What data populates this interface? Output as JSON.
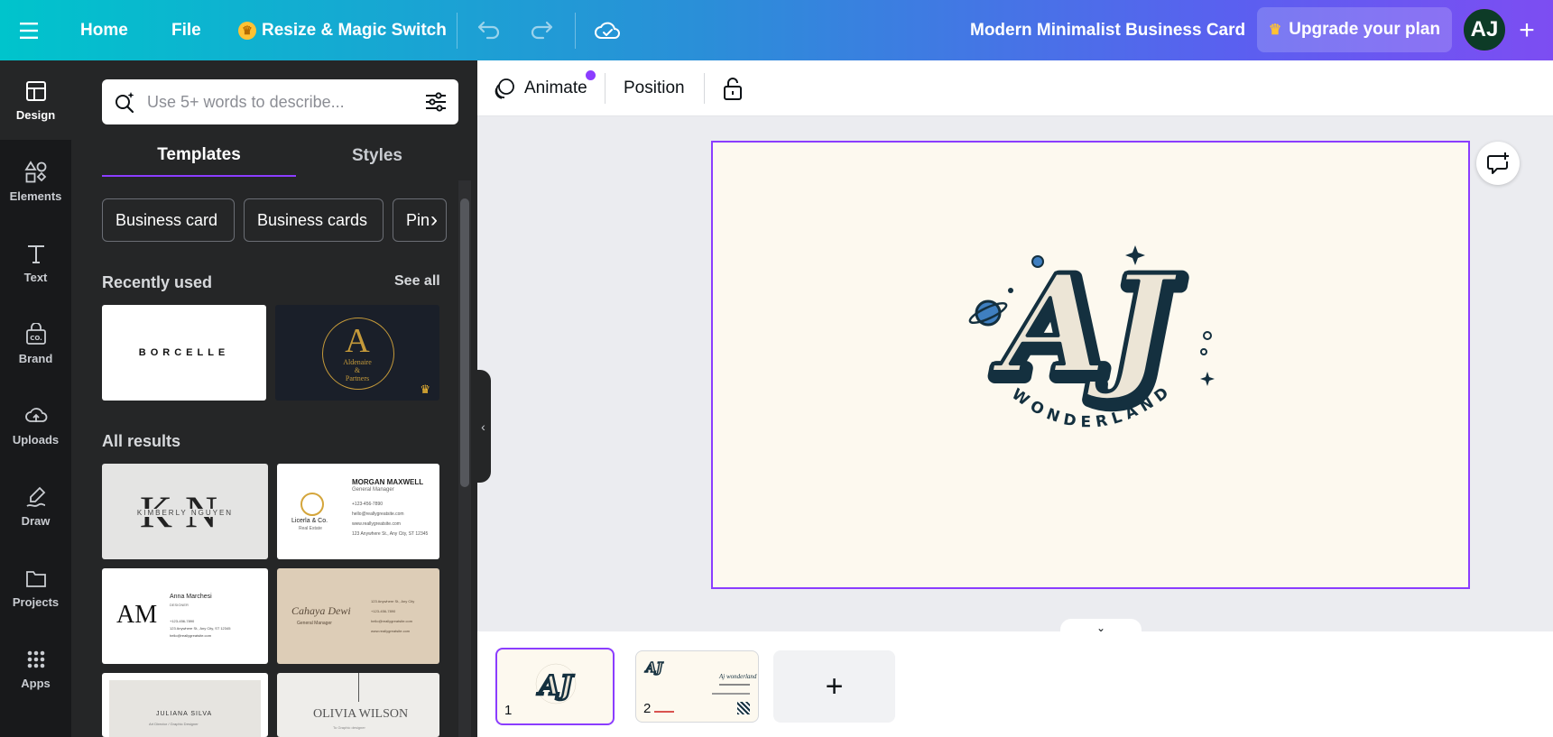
{
  "topbar": {
    "menu_icon": "hamburger-icon",
    "home": "Home",
    "file": "File",
    "resize": "Resize & Magic Switch",
    "undo_icon": "undo-icon",
    "redo_icon": "redo-icon",
    "cloud_icon": "cloud-check-icon",
    "doc_title": "Modern Minimalist Business Card",
    "upgrade": "Upgrade your plan",
    "avatar": "AJ",
    "add_icon": "plus-icon"
  },
  "rail": {
    "items": [
      {
        "label": "Design",
        "icon": "design-icon"
      },
      {
        "label": "Elements",
        "icon": "elements-icon"
      },
      {
        "label": "Text",
        "icon": "text-icon"
      },
      {
        "label": "Brand",
        "icon": "brand-icon"
      },
      {
        "label": "Uploads",
        "icon": "upload-icon"
      },
      {
        "label": "Draw",
        "icon": "draw-icon"
      },
      {
        "label": "Projects",
        "icon": "folder-icon"
      },
      {
        "label": "Apps",
        "icon": "apps-icon"
      }
    ]
  },
  "panel": {
    "search_placeholder": "Use 5+ words to describe...",
    "tabs": [
      "Templates",
      "Styles"
    ],
    "chips": [
      "Business card",
      "Business cards",
      "Pin"
    ],
    "recently_used": "Recently used",
    "see_all": "See all",
    "all_results": "All results",
    "thumbs": {
      "borcelle": "BORCELLE",
      "ab_letter": "A",
      "ab_name": "Aldenaire",
      "ab_amp": "&",
      "ab_partners": "Partners",
      "kn_letters": "KN",
      "kn_name": "KIMBERLY NGUYEN",
      "mm_name": "MORGAN MAXWELL",
      "mm_role": "General Manager",
      "mm_company": "Licerla & Co.",
      "mm_company_sub": "Real Estate",
      "mm_lines": [
        "+123-456-7890",
        "hello@reallygreatsite.com",
        "www.reallygreatsite.com",
        "123 Anywhere St., Any City, ST 12345"
      ],
      "am_letters": "AM",
      "am_name": "Anna Marchesi",
      "am_role": "DESIGNER",
      "am_lines": [
        "+123-456-7890",
        "123 Anywhere St., Any City, ST 12345",
        "hello@reallygreatsite.com"
      ],
      "cd_script": "Cahaya Dewi",
      "cd_role": "General Manager",
      "cd_lines": [
        "123 Anywhere St., Any City",
        "+123-456-7890",
        "hello@reallygreatsite.com",
        "www.reallygreatsite.com"
      ],
      "js_name": "JULIANA SILVA",
      "js_role": "Art Director / Graphic Designer",
      "ow_name": "OLIVIA WILSON",
      "ow_role": "To Graphic designer"
    }
  },
  "toolbar": {
    "animate": "Animate",
    "position": "Position",
    "lock_icon": "lock-icon"
  },
  "canvas": {
    "logo_letters": "AJ",
    "logo_word": "WONDERLAND"
  },
  "pages": {
    "page1": "1",
    "page2": "2",
    "page2_name": "Aj wonderland",
    "add": "+"
  },
  "colors": {
    "accent": "#8b3dff",
    "rail_bg": "#18191b",
    "panel_bg": "#252627",
    "canvas_bg": "#fdf9ef",
    "logo_dark": "#14303f"
  }
}
